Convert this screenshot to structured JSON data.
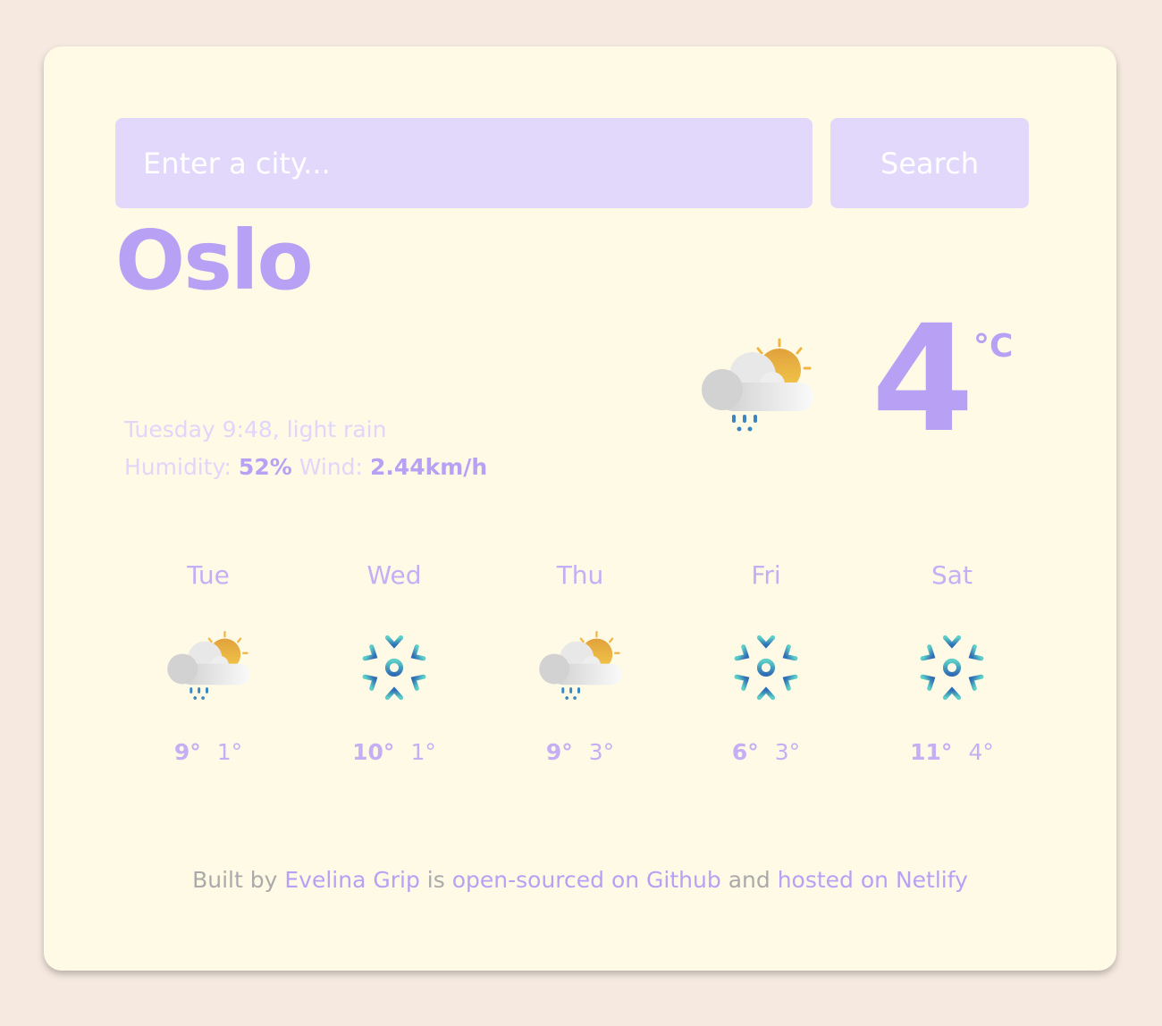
{
  "search": {
    "placeholder": "Enter a city...",
    "button_label": "Search"
  },
  "current": {
    "city": "Oslo",
    "day_time": "Tuesday 9:48",
    "separator": ", ",
    "description": "light rain",
    "humidity_label": "Humidity:",
    "humidity": "52%",
    "wind_label": "Wind:",
    "wind": "2.44km/h",
    "temperature": "4",
    "unit": "°C",
    "icon": "rain-sun-icon"
  },
  "forecast": [
    {
      "day": "Tue",
      "max": "9°",
      "min": "1°",
      "icon": "rain-sun-icon"
    },
    {
      "day": "Wed",
      "max": "10°",
      "min": "1°",
      "icon": "snow-icon"
    },
    {
      "day": "Thu",
      "max": "9°",
      "min": "3°",
      "icon": "rain-sun-icon"
    },
    {
      "day": "Fri",
      "max": "6°",
      "min": "3°",
      "icon": "snow-icon"
    },
    {
      "day": "Sat",
      "max": "11°",
      "min": "4°",
      "icon": "snow-icon"
    }
  ],
  "footer": {
    "built_by": "Built by",
    "author": "Evelina Grip",
    "is": "is",
    "github": "open-sourced on Github",
    "and": "and",
    "netlify": "hosted on Netlify"
  }
}
